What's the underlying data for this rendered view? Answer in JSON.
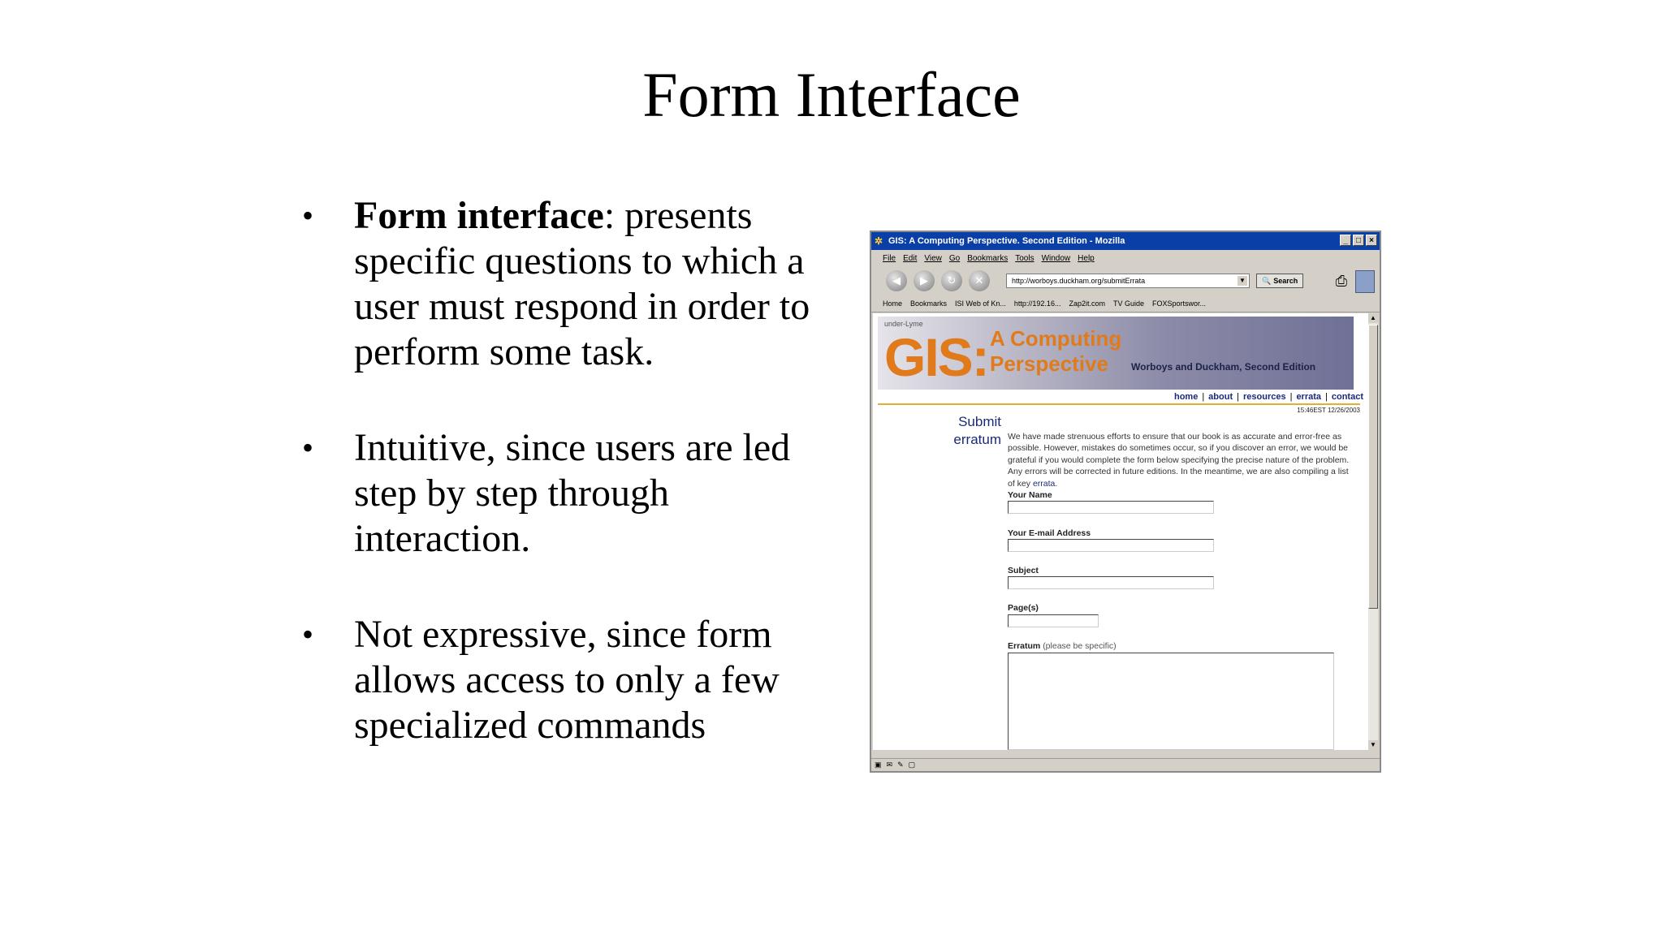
{
  "slide": {
    "title": "Form Interface",
    "bullets": [
      {
        "bold": "Form interface",
        "text": ": presents specific questions to which a user must respond in order to perform some task."
      },
      {
        "bold": "",
        "text": "Intuitive, since users are led step by step through interaction."
      },
      {
        "bold": "",
        "text": "Not expressive, since form allows access to only a few specialized commands"
      }
    ],
    "bullet_symbol": "•"
  },
  "browser": {
    "window_title": "GIS: A Computing Perspective. Second Edition - Mozilla",
    "window_buttons": [
      "_",
      "□",
      "×"
    ],
    "menu": [
      "File",
      "Edit",
      "View",
      "Go",
      "Bookmarks",
      "Tools",
      "Window",
      "Help"
    ],
    "url": "http://worboys.duckham.org/submitErrata",
    "search_label": "Search",
    "bookmarks": [
      "Home",
      "Bookmarks",
      "ISI Web of Kn...",
      "http://192.16...",
      "Zap2it.com",
      "TV Guide",
      "FOXSportswor..."
    ]
  },
  "page": {
    "banner": {
      "place_text": "under-Lyme",
      "logo": "GIS:",
      "subtitle_line1": "A Computing",
      "subtitle_line2": "Perspective",
      "authors": "Worboys and Duckham, Second Edition"
    },
    "nav_links": [
      "home",
      "about",
      "resources",
      "errata",
      "contact"
    ],
    "nav_separator": "|",
    "timestamp": "15:46EST 12/26/2003",
    "side_title_line1": "Submit",
    "side_title_line2": "erratum",
    "intro": "We have made strenuous efforts to ensure that our book is as accurate and error-free as possible. However, mistakes do sometimes occur, so if you discover an error, we would be grateful if you would complete the form below specifying the precise nature of the problem. Any errors will be corrected in future editions. In the meantime, we are also compiling a list of key",
    "intro_link": "errata",
    "fields": {
      "name_label": "Your Name",
      "email_label": "Your E-mail Address",
      "subject_label": "Subject",
      "pages_label": "Page(s)",
      "erratum_label": "Erratum",
      "erratum_hint": "(please be specific)"
    }
  }
}
